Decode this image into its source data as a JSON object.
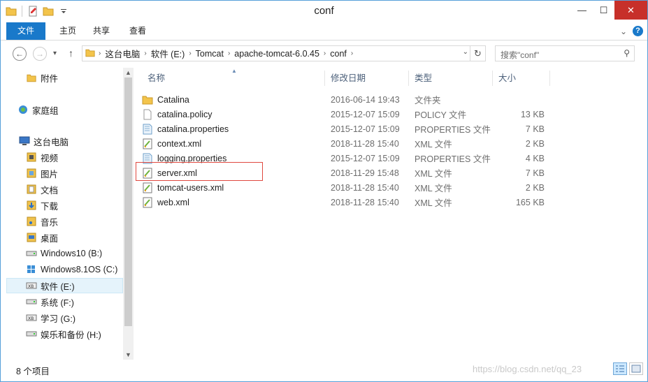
{
  "window": {
    "title": "conf"
  },
  "window_controls": {
    "minimize": "—",
    "maximize": "☐",
    "close": "✕"
  },
  "ribbon": {
    "tabs": [
      "文件",
      "主页",
      "共享",
      "查看"
    ],
    "collapse_glyph": "⌄",
    "help_glyph": "?"
  },
  "nav": {
    "back_glyph": "←",
    "forward_glyph": "→",
    "recent_glyph": "▾",
    "up_glyph": "↑",
    "breadcrumbs": [
      "这台电脑",
      "软件 (E:)",
      "Tomcat",
      "apache-tomcat-6.0.45",
      "conf"
    ],
    "sep_glyph": "›",
    "dropdown_glyph": "⌄",
    "refresh_glyph": "↻"
  },
  "search": {
    "placeholder": "搜索\"conf\"",
    "icon_glyph": "⚲"
  },
  "navpane": {
    "items": [
      {
        "label": "附件",
        "icon": "folder-icon"
      },
      {
        "label": "家庭组",
        "icon": "homegroup-icon"
      },
      {
        "label": "这台电脑",
        "icon": "computer-icon"
      },
      {
        "label": "视频",
        "icon": "video-folder-icon"
      },
      {
        "label": "图片",
        "icon": "pictures-folder-icon"
      },
      {
        "label": "文档",
        "icon": "documents-folder-icon"
      },
      {
        "label": "下载",
        "icon": "downloads-folder-icon"
      },
      {
        "label": "音乐",
        "icon": "music-folder-icon"
      },
      {
        "label": "桌面",
        "icon": "desktop-folder-icon"
      },
      {
        "label": "Windows10 (B:)",
        "icon": "drive-icon"
      },
      {
        "label": "Windows8.1OS (C:)",
        "icon": "system-drive-icon"
      },
      {
        "label": "软件 (E:)",
        "icon": "drive-icon",
        "selected": true
      },
      {
        "label": "系统 (F:)",
        "icon": "drive-icon"
      },
      {
        "label": "学习 (G:)",
        "icon": "drive-icon"
      },
      {
        "label": "娱乐和备份 (H:)",
        "icon": "drive-icon"
      }
    ],
    "scroll_up_glyph": "▲",
    "scroll_down_glyph": "▼"
  },
  "columns": {
    "name": "名称",
    "modified": "修改日期",
    "type": "类型",
    "size": "大小",
    "sort_glyph": "▲"
  },
  "files": [
    {
      "name": "Catalina",
      "date": "2016-06-14 19:43",
      "type": "文件夹",
      "size": "",
      "icon": "folder-icon"
    },
    {
      "name": "catalina.policy",
      "date": "2015-12-07 15:09",
      "type": "POLICY 文件",
      "size": "13 KB",
      "icon": "file-icon"
    },
    {
      "name": "catalina.properties",
      "date": "2015-12-07 15:09",
      "type": "PROPERTIES 文件",
      "size": "7 KB",
      "icon": "properties-file-icon"
    },
    {
      "name": "context.xml",
      "date": "2018-11-28 15:40",
      "type": "XML 文件",
      "size": "2 KB",
      "icon": "xml-file-icon"
    },
    {
      "name": "logging.properties",
      "date": "2015-12-07 15:09",
      "type": "PROPERTIES 文件",
      "size": "4 KB",
      "icon": "properties-file-icon"
    },
    {
      "name": "server.xml",
      "date": "2018-11-29 15:48",
      "type": "XML 文件",
      "size": "7 KB",
      "icon": "xml-file-icon"
    },
    {
      "name": "tomcat-users.xml",
      "date": "2018-11-28 15:40",
      "type": "XML 文件",
      "size": "2 KB",
      "icon": "xml-file-icon"
    },
    {
      "name": "web.xml",
      "date": "2018-11-28 15:40",
      "type": "XML 文件",
      "size": "165 KB",
      "icon": "xml-file-icon"
    }
  ],
  "status": {
    "count": "8 个项目",
    "watermark": "https://blog.csdn.net/qq_23"
  },
  "colors": {
    "accent": "#1979ca",
    "close": "#c7302a",
    "highlight": "#e0483f",
    "selected_bg": "#e5f3fb"
  }
}
